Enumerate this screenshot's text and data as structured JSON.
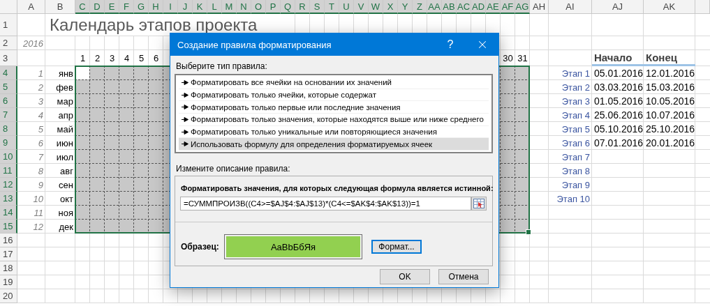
{
  "columns": [
    {
      "label": "A",
      "selected": false
    },
    {
      "label": "B",
      "selected": false
    },
    {
      "label": "C",
      "selected": true
    },
    {
      "label": "D",
      "selected": true
    },
    {
      "label": "E",
      "selected": true
    },
    {
      "label": "F",
      "selected": true
    },
    {
      "label": "G",
      "selected": true
    },
    {
      "label": "H",
      "selected": true
    },
    {
      "label": "I",
      "selected": true
    },
    {
      "label": "J",
      "selected": true
    },
    {
      "label": "K",
      "selected": true
    },
    {
      "label": "L",
      "selected": true
    },
    {
      "label": "M",
      "selected": true
    },
    {
      "label": "N",
      "selected": true
    },
    {
      "label": "O",
      "selected": true
    },
    {
      "label": "P",
      "selected": true
    },
    {
      "label": "Q",
      "selected": true
    },
    {
      "label": "R",
      "selected": true
    },
    {
      "label": "S",
      "selected": true
    },
    {
      "label": "T",
      "selected": true
    },
    {
      "label": "U",
      "selected": true
    },
    {
      "label": "V",
      "selected": true
    },
    {
      "label": "W",
      "selected": true
    },
    {
      "label": "X",
      "selected": true
    },
    {
      "label": "Y",
      "selected": true
    },
    {
      "label": "Z",
      "selected": true
    },
    {
      "label": "AA",
      "selected": true
    },
    {
      "label": "AB",
      "selected": true
    },
    {
      "label": "AC",
      "selected": true
    },
    {
      "label": "AD",
      "selected": true
    },
    {
      "label": "AE",
      "selected": true
    },
    {
      "label": "AF",
      "selected": true
    },
    {
      "label": "AG",
      "selected": true
    },
    {
      "label": "AH",
      "selected": false
    },
    {
      "label": "AI",
      "selected": false
    },
    {
      "label": "AJ",
      "selected": false
    },
    {
      "label": "AK",
      "selected": false
    }
  ],
  "rows": [
    {
      "label": "1",
      "selected": false
    },
    {
      "label": "2",
      "selected": false
    },
    {
      "label": "3",
      "selected": false
    },
    {
      "label": "4",
      "selected": true
    },
    {
      "label": "5",
      "selected": true
    },
    {
      "label": "6",
      "selected": true
    },
    {
      "label": "7",
      "selected": true
    },
    {
      "label": "8",
      "selected": true
    },
    {
      "label": "9",
      "selected": true
    },
    {
      "label": "10",
      "selected": true
    },
    {
      "label": "11",
      "selected": true
    },
    {
      "label": "12",
      "selected": true
    },
    {
      "label": "13",
      "selected": true
    },
    {
      "label": "14",
      "selected": true
    },
    {
      "label": "15",
      "selected": true
    },
    {
      "label": "16",
      "selected": false
    },
    {
      "label": "17",
      "selected": false
    },
    {
      "label": "18",
      "selected": false
    },
    {
      "label": "19",
      "selected": false
    },
    {
      "label": "20",
      "selected": false
    }
  ],
  "sheet": {
    "title": "Календарь этапов проекта",
    "year": "2016",
    "day_numbers_start": [
      "1",
      "2",
      "3",
      "4",
      "5",
      "6"
    ],
    "day_numbers_end": [
      "30",
      "31"
    ],
    "months": [
      {
        "number": "1",
        "name": "янв"
      },
      {
        "number": "2",
        "name": "фев"
      },
      {
        "number": "3",
        "name": "мар"
      },
      {
        "number": "4",
        "name": "апр"
      },
      {
        "number": "5",
        "name": "май"
      },
      {
        "number": "6",
        "name": "июн"
      },
      {
        "number": "7",
        "name": "июл"
      },
      {
        "number": "8",
        "name": "авг"
      },
      {
        "number": "9",
        "name": "сен"
      },
      {
        "number": "10",
        "name": "окт"
      },
      {
        "number": "11",
        "name": "ноя"
      },
      {
        "number": "12",
        "name": "дек"
      }
    ],
    "calendar": {
      "selected": true
    },
    "stage_headers": [
      "Начало",
      "Конец"
    ],
    "stages": [
      {
        "name": "Этап 1",
        "start": "05.01.2016",
        "end": "12.01.2016"
      },
      {
        "name": "Этап 2",
        "start": "03.03.2016",
        "end": "15.03.2016"
      },
      {
        "name": "Этап 3",
        "start": "01.05.2016",
        "end": "10.05.2016"
      },
      {
        "name": "Этап 4",
        "start": "25.06.2016",
        "end": "10.07.2016"
      },
      {
        "name": "Этап 5",
        "start": "05.10.2016",
        "end": "25.10.2016"
      },
      {
        "name": "Этап 6",
        "start": "07.01.2016",
        "end": "20.01.2016"
      },
      {
        "name": "Этап 7"
      },
      {
        "name": "Этап 8"
      },
      {
        "name": "Этап 9"
      },
      {
        "name": "Этап 10"
      }
    ]
  },
  "dialog": {
    "title": "Создание правила форматирования",
    "help": "?",
    "rule_type_label": "Выберите тип правила:",
    "rule_types": [
      {
        "label": "Форматировать все ячейки на основании их значений",
        "selected": false
      },
      {
        "label": "Форматировать только ячейки, которые содержат",
        "selected": false
      },
      {
        "label": "Форматировать только первые или последние значения",
        "selected": false
      },
      {
        "label": "Форматировать только значения, которые находятся выше или ниже среднего",
        "selected": false
      },
      {
        "label": "Форматировать только уникальные или повторяющиеся значения",
        "selected": false
      },
      {
        "label": "Использовать формулу для определения форматируемых ячеек",
        "selected": true
      }
    ],
    "description_label": "Измените описание правила:",
    "formula_label": "Форматировать значения, для которых следующая формула является истинной:",
    "formula": "=СУММПРОИЗВ((C4>=$AJ$4:$AJ$13)*(C4<=$AK$4:$AK$13))=1",
    "sample_label": "Образец:",
    "sample_text": "AaBbБбЯя",
    "format_button": {
      "label": "Формат...",
      "focused": true
    },
    "buttons": [
      "OK",
      "Отмена"
    ]
  }
}
